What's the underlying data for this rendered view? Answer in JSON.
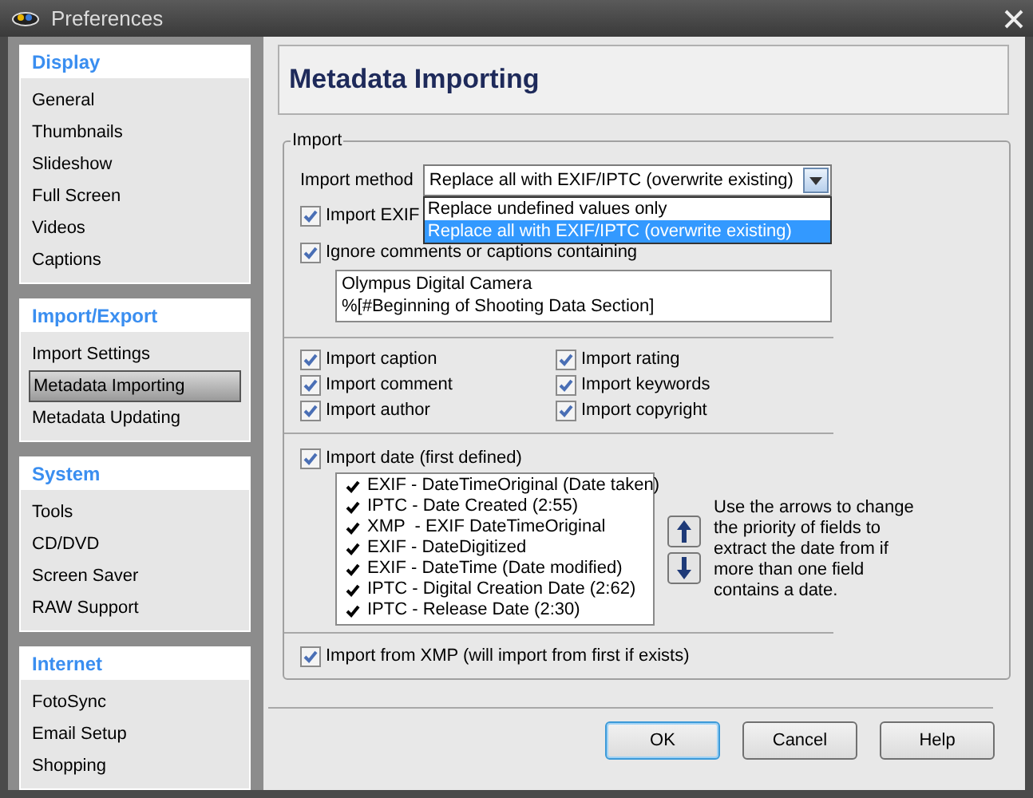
{
  "window": {
    "title": "Preferences"
  },
  "sidebar": {
    "sections": [
      {
        "title": "Display",
        "items": [
          {
            "label": "General",
            "selected": false
          },
          {
            "label": "Thumbnails",
            "selected": false
          },
          {
            "label": "Slideshow",
            "selected": false
          },
          {
            "label": "Full Screen",
            "selected": false
          },
          {
            "label": "Videos",
            "selected": false
          },
          {
            "label": "Captions",
            "selected": false
          }
        ]
      },
      {
        "title": "Import/Export",
        "items": [
          {
            "label": "Import Settings",
            "selected": false
          },
          {
            "label": "Metadata Importing",
            "selected": true
          },
          {
            "label": "Metadata Updating",
            "selected": false
          }
        ]
      },
      {
        "title": "System",
        "items": [
          {
            "label": "Tools",
            "selected": false
          },
          {
            "label": "CD/DVD",
            "selected": false
          },
          {
            "label": "Screen Saver",
            "selected": false
          },
          {
            "label": "RAW Support",
            "selected": false
          }
        ]
      },
      {
        "title": "Internet",
        "items": [
          {
            "label": "FotoSync",
            "selected": false
          },
          {
            "label": "Email Setup",
            "selected": false
          },
          {
            "label": "Shopping",
            "selected": false
          }
        ]
      }
    ]
  },
  "page": {
    "title": "Metadata Importing"
  },
  "import": {
    "legend": "Import",
    "import_method": {
      "label": "Import method",
      "value": "Replace all with EXIF/IPTC (overwrite existing)",
      "expanded": true,
      "options": [
        {
          "label": "Replace undefined values only",
          "selected": false
        },
        {
          "label": "Replace all with EXIF/IPTC (overwrite existing)",
          "selected": true
        }
      ]
    },
    "options": [
      {
        "label": "Import EXIF",
        "checked": true
      },
      {
        "label": "Ignore comments or captions containing",
        "checked": true
      }
    ],
    "ignore_text": [
      "Olympus Digital Camera",
      "%[#Beginning of Shooting Data Section]"
    ],
    "fields": [
      {
        "label": "Import caption",
        "checked": true
      },
      {
        "label": "Import comment",
        "checked": true
      },
      {
        "label": "Import author",
        "checked": true
      },
      {
        "label": "Import rating",
        "checked": true
      },
      {
        "label": "Import keywords",
        "checked": true
      },
      {
        "label": "Import copyright",
        "checked": true
      }
    ],
    "import_date": {
      "label": "Import date (first defined)",
      "checked": true
    },
    "date_fields": [
      {
        "label": "EXIF - DateTimeOriginal (Date taken)",
        "checked": true
      },
      {
        "label": "IPTC - Date Created (2:55)",
        "checked": true
      },
      {
        "label": "XMP  - EXIF DateTimeOriginal",
        "checked": true
      },
      {
        "label": "EXIF - DateDigitized",
        "checked": true
      },
      {
        "label": "EXIF - DateTime (Date modified)",
        "checked": true
      },
      {
        "label": "IPTC - Digital Creation Date (2:62)",
        "checked": true
      },
      {
        "label": "IPTC - Release Date (2:30)",
        "checked": true
      }
    ],
    "help": "Use the arrows to change the priority of fields to extract the date from if more than one field contains a date.",
    "import_xmp": {
      "label": "Import from XMP (will import from first if exists)",
      "checked": true
    }
  },
  "buttons": [
    {
      "label": "OK",
      "default": true
    },
    {
      "label": "Cancel",
      "default": false
    },
    {
      "label": "Help",
      "default": false
    }
  ]
}
